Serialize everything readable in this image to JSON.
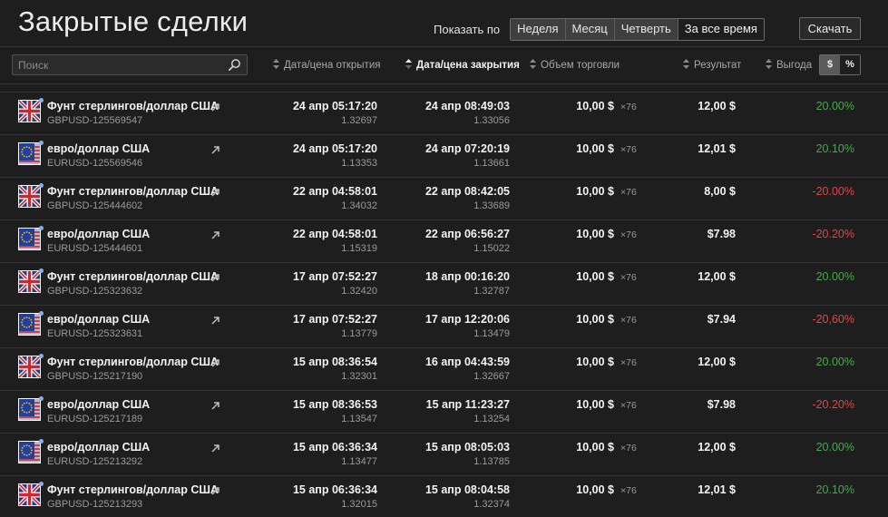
{
  "title": "Закрытые сделки",
  "period": {
    "label": "Показать по",
    "options": [
      "Неделя",
      "Месяц",
      "Четверть",
      "За все время"
    ],
    "selected": "За все время"
  },
  "download_label": "Скачать",
  "search": {
    "placeholder": "Поиск"
  },
  "columns": {
    "open": "Дата/цена открытия",
    "close": "Дата/цена закрытия",
    "volume": "Объем торговли",
    "result": "Результат",
    "profit": "Выгода"
  },
  "sorted_column": "close",
  "unit_toggle": {
    "options": [
      "$",
      "%"
    ],
    "selected": "$"
  },
  "colors": {
    "positive": "#4aa84e",
    "negative": "#e04646",
    "background": "#1e1e1e"
  },
  "rows": [
    {
      "flag": "gb-flag-icon",
      "name": "Фунт стерлингов/доллар США",
      "id": "GBPUSD-125569547",
      "open_date": "24 апр 05:17:20",
      "open_price": "1.32697",
      "close_date": "24 апр 08:49:03",
      "close_price": "1.33056",
      "volume": "10,00 $",
      "mult": "×76",
      "result": "12,00 $",
      "profit": "20.00%"
    },
    {
      "flag": "eu-flag-icon",
      "name": "евро/доллар США",
      "id": "EURUSD-125569546",
      "open_date": "24 апр 05:17:20",
      "open_price": "1.13353",
      "close_date": "24 апр 07:20:19",
      "close_price": "1.13661",
      "volume": "10,00 $",
      "mult": "×76",
      "result": "12,01 $",
      "profit": "20.10%"
    },
    {
      "flag": "gb-flag-icon",
      "name": "Фунт стерлингов/доллар США",
      "id": "GBPUSD-125444602",
      "open_date": "22 апр 04:58:01",
      "open_price": "1.34032",
      "close_date": "22 апр 08:42:05",
      "close_price": "1.33689",
      "volume": "10,00 $",
      "mult": "×76",
      "result": "8,00 $",
      "profit": "-20.00%"
    },
    {
      "flag": "eu-flag-icon",
      "name": "евро/доллар США",
      "id": "EURUSD-125444601",
      "open_date": "22 апр 04:58:01",
      "open_price": "1.15319",
      "close_date": "22 апр 06:56:27",
      "close_price": "1.15022",
      "volume": "10,00 $",
      "mult": "×76",
      "result": "$7.98",
      "profit": "-20.20%"
    },
    {
      "flag": "gb-flag-icon",
      "name": "Фунт стерлингов/доллар США",
      "id": "GBPUSD-125323632",
      "open_date": "17 апр 07:52:27",
      "open_price": "1.32420",
      "close_date": "18 апр 00:16:20",
      "close_price": "1.32787",
      "volume": "10,00 $",
      "mult": "×76",
      "result": "12,00 $",
      "profit": "20.00%"
    },
    {
      "flag": "eu-flag-icon",
      "name": "евро/доллар США",
      "id": "EURUSD-125323631",
      "open_date": "17 апр 07:52:27",
      "open_price": "1.13779",
      "close_date": "17 апр 12:20:06",
      "close_price": "1.13479",
      "volume": "10,00 $",
      "mult": "×76",
      "result": "$7.94",
      "profit": "-20,60%"
    },
    {
      "flag": "gb-flag-icon",
      "name": "Фунт стерлингов/доллар США",
      "id": "GBPUSD-125217190",
      "open_date": "15 апр 08:36:54",
      "open_price": "1.32301",
      "close_date": "16 апр 04:43:59",
      "close_price": "1.32667",
      "volume": "10,00 $",
      "mult": "×76",
      "result": "12,00 $",
      "profit": "20.00%"
    },
    {
      "flag": "eu-flag-icon",
      "name": "евро/доллар США",
      "id": "EURUSD-125217189",
      "open_date": "15 апр 08:36:53",
      "open_price": "1.13547",
      "close_date": "15 апр 11:23:27",
      "close_price": "1.13254",
      "volume": "10,00 $",
      "mult": "×76",
      "result": "$7.98",
      "profit": "-20.20%"
    },
    {
      "flag": "eu-flag-icon",
      "name": "евро/доллар США",
      "id": "EURUSD-125213292",
      "open_date": "15 апр 06:36:34",
      "open_price": "1.13477",
      "close_date": "15 апр 08:05:03",
      "close_price": "1.13785",
      "volume": "10,00 $",
      "mult": "×76",
      "result": "12,00 $",
      "profit": "20.00%"
    },
    {
      "flag": "gb-flag-icon",
      "name": "Фунт стерлингов/доллар США",
      "id": "GBPUSD-125213293",
      "open_date": "15 апр 06:36:34",
      "open_price": "1.32015",
      "close_date": "15 апр 08:04:58",
      "close_price": "1.32374",
      "volume": "10,00 $",
      "mult": "×76",
      "result": "12,01 $",
      "profit": "20.10%"
    }
  ]
}
